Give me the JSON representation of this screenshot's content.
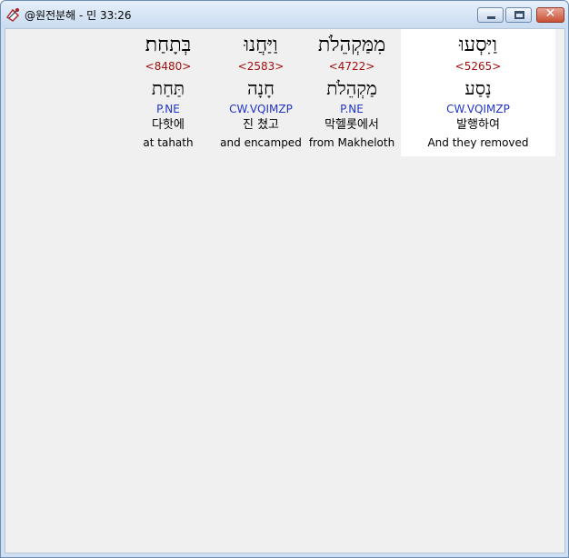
{
  "window": {
    "title": "@원전분해 - 민 33:26",
    "close_glyph": "✕",
    "icons": {
      "app": "parchment-pen-icon",
      "minimize": "minimize-icon",
      "maximize": "maximize-icon",
      "close": "close-icon"
    },
    "colors": {
      "strong": "#a01010",
      "parse": "#2233cc",
      "selected_bg": "#ffffff",
      "client_bg": "#f0f0f0"
    }
  },
  "words": [
    {
      "hebrew": "בְּתָחַת׃",
      "strong": "<8480>",
      "lemma": "תַּחַת",
      "parse": "P.NE",
      "korean": "다핫에",
      "english": "at tahath",
      "selected": false
    },
    {
      "hebrew": "וַיַּחֲנוּ",
      "strong": "<2583>",
      "lemma": "חָנָה",
      "parse": "CW.VQIMZP",
      "korean": "진 쳤고",
      "english": "and encamped",
      "selected": false
    },
    {
      "hebrew": "מִמַּקְהֵלֹת",
      "strong": "<4722>",
      "lemma": "מַקְהֵלֹת",
      "parse": "P.NE",
      "korean": "막헬롯에서",
      "english": "from Makheloth",
      "selected": false
    },
    {
      "hebrew": "וַיִּסְעוּ",
      "strong": "<5265>",
      "lemma": "נָסַע",
      "parse": "CW.VQIMZP",
      "korean": "발행하여",
      "english": "And they removed",
      "selected": true
    }
  ]
}
